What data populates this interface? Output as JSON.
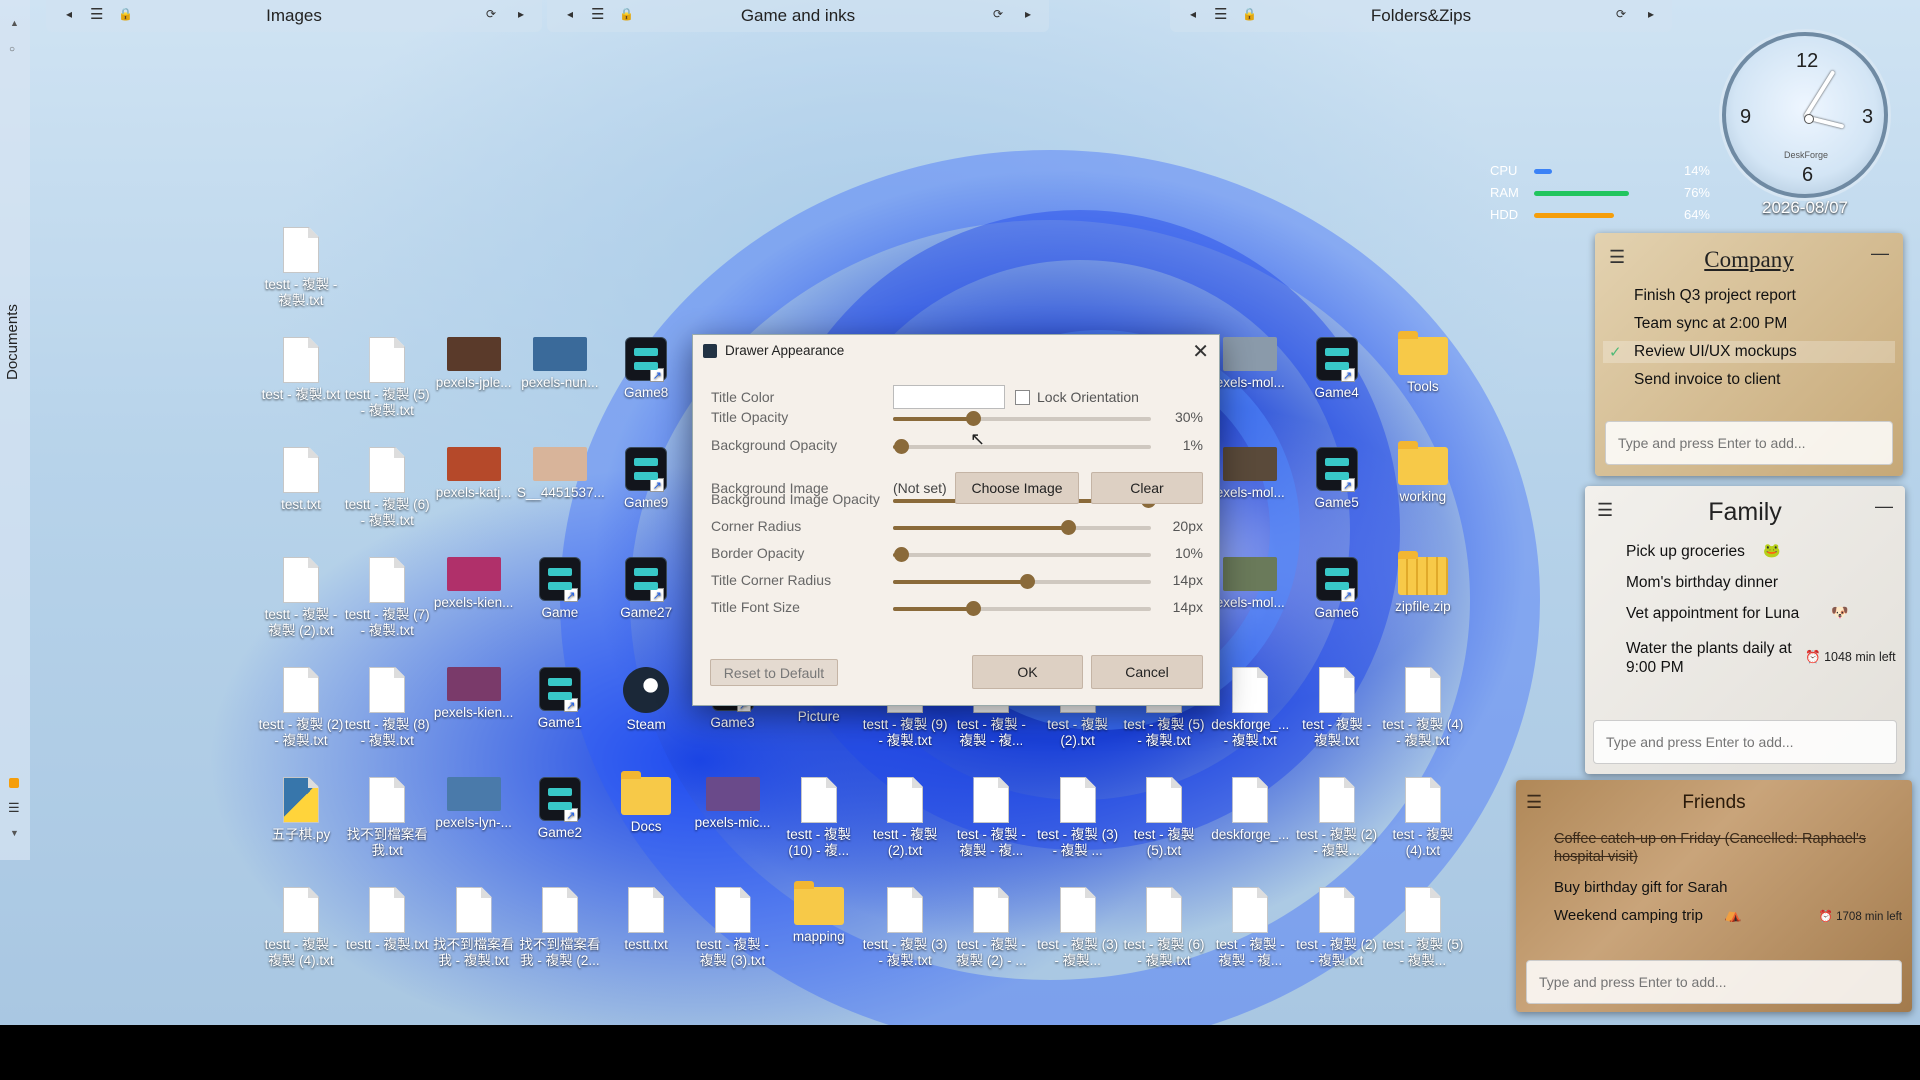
{
  "sidebar": {
    "label": "Documents"
  },
  "fences": [
    {
      "title": "Images"
    },
    {
      "title": "Game and inks"
    },
    {
      "title": "Folders&Zips"
    }
  ],
  "clock": {
    "numbers": [
      "12",
      "3",
      "6",
      "9"
    ],
    "brand": "DeskForge",
    "date": "2026-08/07"
  },
  "stats": [
    {
      "label": "CPU",
      "value": "14%",
      "level": 0.14,
      "color": "#3b82f6"
    },
    {
      "label": "RAM",
      "value": "76%",
      "level": 0.76,
      "color": "#22c55e"
    },
    {
      "label": "HDD",
      "value": "64%",
      "level": 0.64,
      "color": "#f59e0b"
    }
  ],
  "notes": {
    "company": {
      "title": "Company",
      "items": [
        {
          "text": "Finish Q3 project report"
        },
        {
          "text": "Team sync at 2:00 PM"
        },
        {
          "text": "Review UI/UX mockups",
          "done": true
        },
        {
          "text": "Send invoice to client"
        }
      ],
      "placeholder": "Type and press Enter to add..."
    },
    "family": {
      "title": "Family",
      "items": [
        {
          "text": "Pick up groceries"
        },
        {
          "text": "Mom's birthday dinner"
        },
        {
          "text": "Vet appointment for Luna"
        },
        {
          "text": "Water the plants daily at 9:00 PM",
          "timer": "1048 min left"
        }
      ],
      "placeholder": "Type and press Enter to add..."
    },
    "friends": {
      "title": "Friends",
      "items": [
        {
          "text": "Coffee catch-up on Friday (Cancelled: Raphael's hospital visit)",
          "struck": true
        },
        {
          "text": "Buy birthday gift for Sarah"
        },
        {
          "text": "Weekend camping trip",
          "timer": "1708 min left"
        }
      ],
      "placeholder": "Type and press Enter to add..."
    }
  },
  "dialog": {
    "title": "Drawer Appearance",
    "title_color_label": "Title Color",
    "lock_label": "Lock Orientation",
    "bg_image_label": "Background Image",
    "bg_image_value": "(Not set)",
    "choose_label": "Choose Image",
    "clear_label": "Clear",
    "reset_label": "Reset to Default",
    "ok_label": "OK",
    "cancel_label": "Cancel",
    "sliders": [
      {
        "label": "Title Opacity",
        "value": "30%",
        "level": 0.31
      },
      {
        "label": "Background Opacity",
        "value": "1%",
        "level": 0.03
      },
      {
        "label": "Background Image Opacity",
        "value": "100%",
        "level": 0.99
      },
      {
        "label": "Corner Radius",
        "value": "20px",
        "level": 0.68
      },
      {
        "label": "Border Opacity",
        "value": "10%",
        "level": 0.03
      },
      {
        "label": "Title Corner Radius",
        "value": "14px",
        "level": 0.52
      },
      {
        "label": "Title Font Size",
        "value": "14px",
        "level": 0.31
      }
    ]
  },
  "icons": [
    {
      "label": "testt - 複製 - 複製.txt",
      "kind": "doc"
    },
    {
      "label": "test - 複製.txt",
      "kind": "doc"
    },
    {
      "label": "testt - 複製 (5) - 複製.txt",
      "kind": "doc"
    },
    {
      "label": "pexels-jple...",
      "kind": "img",
      "color": "#5a3a2a"
    },
    {
      "label": "pexels-nun...",
      "kind": "img",
      "color": "#3a6a9a"
    },
    {
      "label": "Game8",
      "kind": "game"
    },
    {
      "label": "test.txt",
      "kind": "doc"
    },
    {
      "label": "testt - 複製 (6) - 複製.txt",
      "kind": "doc"
    },
    {
      "label": "pexels-katj...",
      "kind": "img",
      "color": "#b5492a"
    },
    {
      "label": "S__4451537...",
      "kind": "img",
      "color": "#d8b49a"
    },
    {
      "label": "Game9",
      "kind": "game"
    },
    {
      "label": "testt - 複製 - 複製 (2).txt",
      "kind": "doc"
    },
    {
      "label": "testt - 複製 (7) - 複製.txt",
      "kind": "doc"
    },
    {
      "label": "pexels-kien...",
      "kind": "img",
      "color": "#b0306a"
    },
    {
      "label": "Game",
      "kind": "game"
    },
    {
      "label": "Game27",
      "kind": "game"
    },
    {
      "label": "testt - 複製 (2) - 複製.txt",
      "kind": "doc"
    },
    {
      "label": "testt - 複製 (8) - 複製.txt",
      "kind": "doc"
    },
    {
      "label": "pexels-kien...",
      "kind": "img",
      "color": "#7a3a6a"
    },
    {
      "label": "Game1",
      "kind": "game"
    },
    {
      "label": "Steam",
      "kind": "steam"
    },
    {
      "label": "Game3",
      "kind": "game"
    },
    {
      "label": "Picture",
      "kind": "folder"
    },
    {
      "label": "testt - 複製 (9) - 複製.txt",
      "kind": "doc"
    },
    {
      "label": "test - 複製 - 複製 - 複...",
      "kind": "doc"
    },
    {
      "label": "test - 複製 (2).txt",
      "kind": "doc"
    },
    {
      "label": "test - 複製 (5) - 複製.txt",
      "kind": "doc"
    },
    {
      "label": "deskforge_... - 複製.txt",
      "kind": "doc"
    },
    {
      "label": "test - 複製 - 複製.txt",
      "kind": "doc"
    },
    {
      "label": "test - 複製 (4) - 複製.txt",
      "kind": "doc"
    },
    {
      "label": "五子棋.py",
      "kind": "py"
    },
    {
      "label": "找不到檔案看我.txt",
      "kind": "doc"
    },
    {
      "label": "pexels-lyn-...",
      "kind": "img",
      "color": "#4a7aaa"
    },
    {
      "label": "Game2",
      "kind": "game"
    },
    {
      "label": "Docs",
      "kind": "folder"
    },
    {
      "label": "pexels-mic...",
      "kind": "img",
      "color": "#6a4a8a"
    },
    {
      "label": "testt - 複製 (10) - 複...",
      "kind": "doc"
    },
    {
      "label": "testt - 複製 (2).txt",
      "kind": "doc"
    },
    {
      "label": "test - 複製 - 複製 - 複...",
      "kind": "doc"
    },
    {
      "label": "test - 複製 (3) - 複製 ...",
      "kind": "doc"
    },
    {
      "label": "test - 複製 (5).txt",
      "kind": "doc"
    },
    {
      "label": "deskforge_...",
      "kind": "doc"
    },
    {
      "label": "test - 複製 (2) - 複製...",
      "kind": "doc"
    },
    {
      "label": "test - 複製 (4).txt",
      "kind": "doc"
    },
    {
      "label": "testt - 複製 - 複製 (4).txt",
      "kind": "doc"
    },
    {
      "label": "testt - 複製.txt",
      "kind": "doc"
    },
    {
      "label": "找不到檔案看我 - 複製.txt",
      "kind": "doc"
    },
    {
      "label": "找不到檔案看我 - 複製 (2...",
      "kind": "doc"
    },
    {
      "label": "testt.txt",
      "kind": "doc"
    },
    {
      "label": "testt - 複製 - 複製 (3).txt",
      "kind": "doc"
    },
    {
      "label": "mapping",
      "kind": "folder"
    },
    {
      "label": "testt - 複製 (3) - 複製.txt",
      "kind": "doc"
    },
    {
      "label": "test - 複製 - 複製 (2) - ...",
      "kind": "doc"
    },
    {
      "label": "test - 複製 (3) - 複製...",
      "kind": "doc"
    },
    {
      "label": "test - 複製 (6) - 複製.txt",
      "kind": "doc"
    },
    {
      "label": "test - 複製 - 複製 - 複...",
      "kind": "doc"
    },
    {
      "label": "test - 複製 (2) - 複製.txt",
      "kind": "doc"
    },
    {
      "label": "test - 複製 (5) - 複製...",
      "kind": "doc"
    },
    {
      "label": "exels-mol...",
      "kind": "img",
      "color": "#8a9aaa"
    },
    {
      "label": "Game4",
      "kind": "game"
    },
    {
      "label": "Tools",
      "kind": "folder"
    },
    {
      "label": "exels-mol...",
      "kind": "img",
      "color": "#5a4a3a"
    },
    {
      "label": "Game5",
      "kind": "game"
    },
    {
      "label": "working",
      "kind": "folder"
    },
    {
      "label": "exels-mol...",
      "kind": "img",
      "color": "#6a7a5a"
    },
    {
      "label": "Game6",
      "kind": "game"
    },
    {
      "label": "zipfile.zip",
      "kind": "zip"
    }
  ]
}
